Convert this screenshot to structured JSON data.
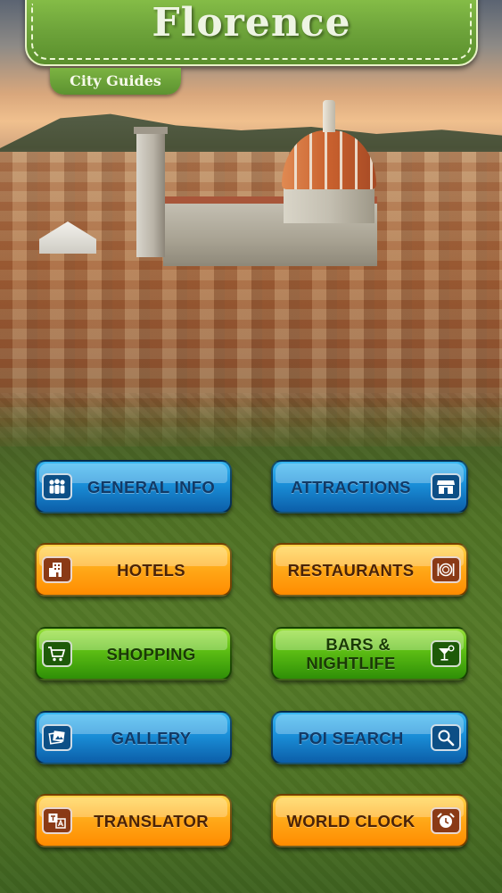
{
  "header": {
    "title": "Florence",
    "subtitle": "City Guides"
  },
  "menu": [
    {
      "id": "general-info",
      "label": "GENERAL INFO",
      "color": "blue",
      "icon": "people-icon"
    },
    {
      "id": "attractions",
      "label": "ATTRACTIONS",
      "color": "blue",
      "icon": "storefront-icon"
    },
    {
      "id": "hotels",
      "label": "HOTELS",
      "color": "orange",
      "icon": "building-icon"
    },
    {
      "id": "restaurants",
      "label": "RESTAURANTS",
      "color": "orange",
      "icon": "plate-cutlery-icon"
    },
    {
      "id": "shopping",
      "label": "SHOPPING",
      "color": "green",
      "icon": "shopping-cart-icon"
    },
    {
      "id": "bars-nightlife",
      "label": "BARS & NIGHTLIFE",
      "line1": "BARS &",
      "line2": "NIGHTLIFE",
      "color": "green",
      "icon": "cocktail-icon"
    },
    {
      "id": "gallery",
      "label": "GALLERY",
      "color": "blue",
      "icon": "photos-icon"
    },
    {
      "id": "poi-search",
      "label": "POI SEARCH",
      "color": "blue",
      "icon": "magnifier-icon"
    },
    {
      "id": "translator",
      "label": "TRANSLATOR",
      "color": "orange",
      "icon": "translate-icon"
    },
    {
      "id": "world-clock",
      "label": "WORLD CLOCK",
      "color": "orange",
      "icon": "alarm-clock-icon"
    }
  ],
  "colors": {
    "header_green": "#6da33a",
    "button_blue": "#1a8fd8",
    "button_orange": "#ffab1a",
    "button_green": "#5cbd14"
  }
}
